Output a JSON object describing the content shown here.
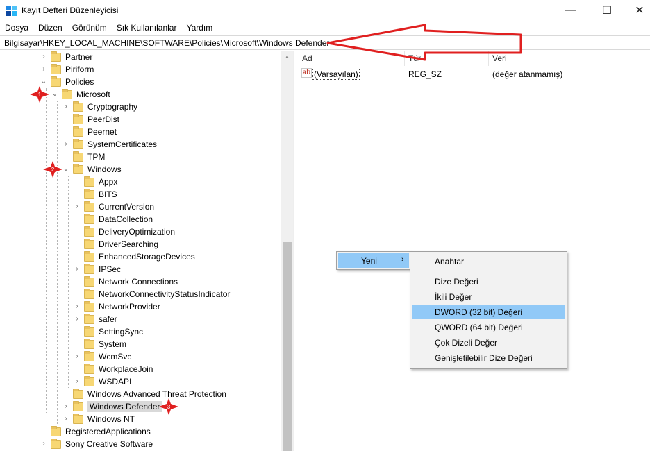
{
  "window": {
    "title": "Kayıt Defteri Düzenleyicisi",
    "controls": {
      "minimize": "—",
      "maximize": "☐",
      "close": "✕"
    },
    "icon_colors": [
      "#1e88e5",
      "#4fc3f7",
      "#0d47a1",
      "#29b6f6"
    ]
  },
  "menu": [
    "Dosya",
    "Düzen",
    "Görünüm",
    "Sık Kullanılanlar",
    "Yardım"
  ],
  "address": "Bilgisayar\\HKEY_LOCAL_MACHINE\\SOFTWARE\\Policies\\Microsoft\\Windows Defender",
  "tree": [
    {
      "label": "Partner",
      "chevron": "›"
    },
    {
      "label": "Piriform",
      "chevron": "›"
    },
    {
      "label": "Policies",
      "chevron": "⌄"
    },
    {
      "label": "Microsoft",
      "chevron": "⌄"
    },
    {
      "label": "Cryptography",
      "chevron": "›"
    },
    {
      "label": "PeerDist",
      "chevron": ""
    },
    {
      "label": "Peernet",
      "chevron": ""
    },
    {
      "label": "SystemCertificates",
      "chevron": "›"
    },
    {
      "label": "TPM",
      "chevron": ""
    },
    {
      "label": "Windows",
      "chevron": "⌄"
    },
    {
      "label": "Appx",
      "chevron": ""
    },
    {
      "label": "BITS",
      "chevron": ""
    },
    {
      "label": "CurrentVersion",
      "chevron": "›"
    },
    {
      "label": "DataCollection",
      "chevron": ""
    },
    {
      "label": "DeliveryOptimization",
      "chevron": ""
    },
    {
      "label": "DriverSearching",
      "chevron": ""
    },
    {
      "label": "EnhancedStorageDevices",
      "chevron": ""
    },
    {
      "label": "IPSec",
      "chevron": "›"
    },
    {
      "label": "Network Connections",
      "chevron": ""
    },
    {
      "label": "NetworkConnectivityStatusIndicator",
      "chevron": ""
    },
    {
      "label": "NetworkProvider",
      "chevron": "›"
    },
    {
      "label": "safer",
      "chevron": "›"
    },
    {
      "label": "SettingSync",
      "chevron": ""
    },
    {
      "label": "System",
      "chevron": ""
    },
    {
      "label": "WcmSvc",
      "chevron": "›"
    },
    {
      "label": "WorkplaceJoin",
      "chevron": ""
    },
    {
      "label": "WSDAPI",
      "chevron": "›"
    },
    {
      "label": "Windows Advanced Threat Protection",
      "chevron": ""
    },
    {
      "label": "Windows Defender",
      "chevron": "›",
      "selected": true
    },
    {
      "label": "Windows NT",
      "chevron": "›"
    },
    {
      "label": "RegisteredApplications",
      "chevron": ""
    },
    {
      "label": "Sony Creative Software",
      "chevron": "›"
    }
  ],
  "values_pane": {
    "columns": [
      "Ad",
      "Tür",
      "Veri"
    ],
    "rows": [
      {
        "icon": "ab",
        "name": "(Varsayılan)",
        "type": "REG_SZ",
        "data": "(değer atanmamış)"
      }
    ]
  },
  "context_menu": {
    "new_item": "Yeni",
    "submenu": [
      "Anahtar",
      "Dize Değeri",
      "İkili Değer",
      "DWORD (32 bit) Değeri",
      "QWORD (64 bit) Değeri",
      "Çok Dizeli Değer",
      "Genişletilebilir Dize Değeri"
    ],
    "highlighted": "DWORD (32 bit) Değeri"
  },
  "annotations": {
    "marker_labels": [
      "1",
      "2",
      "3"
    ],
    "color": "#e02020"
  }
}
